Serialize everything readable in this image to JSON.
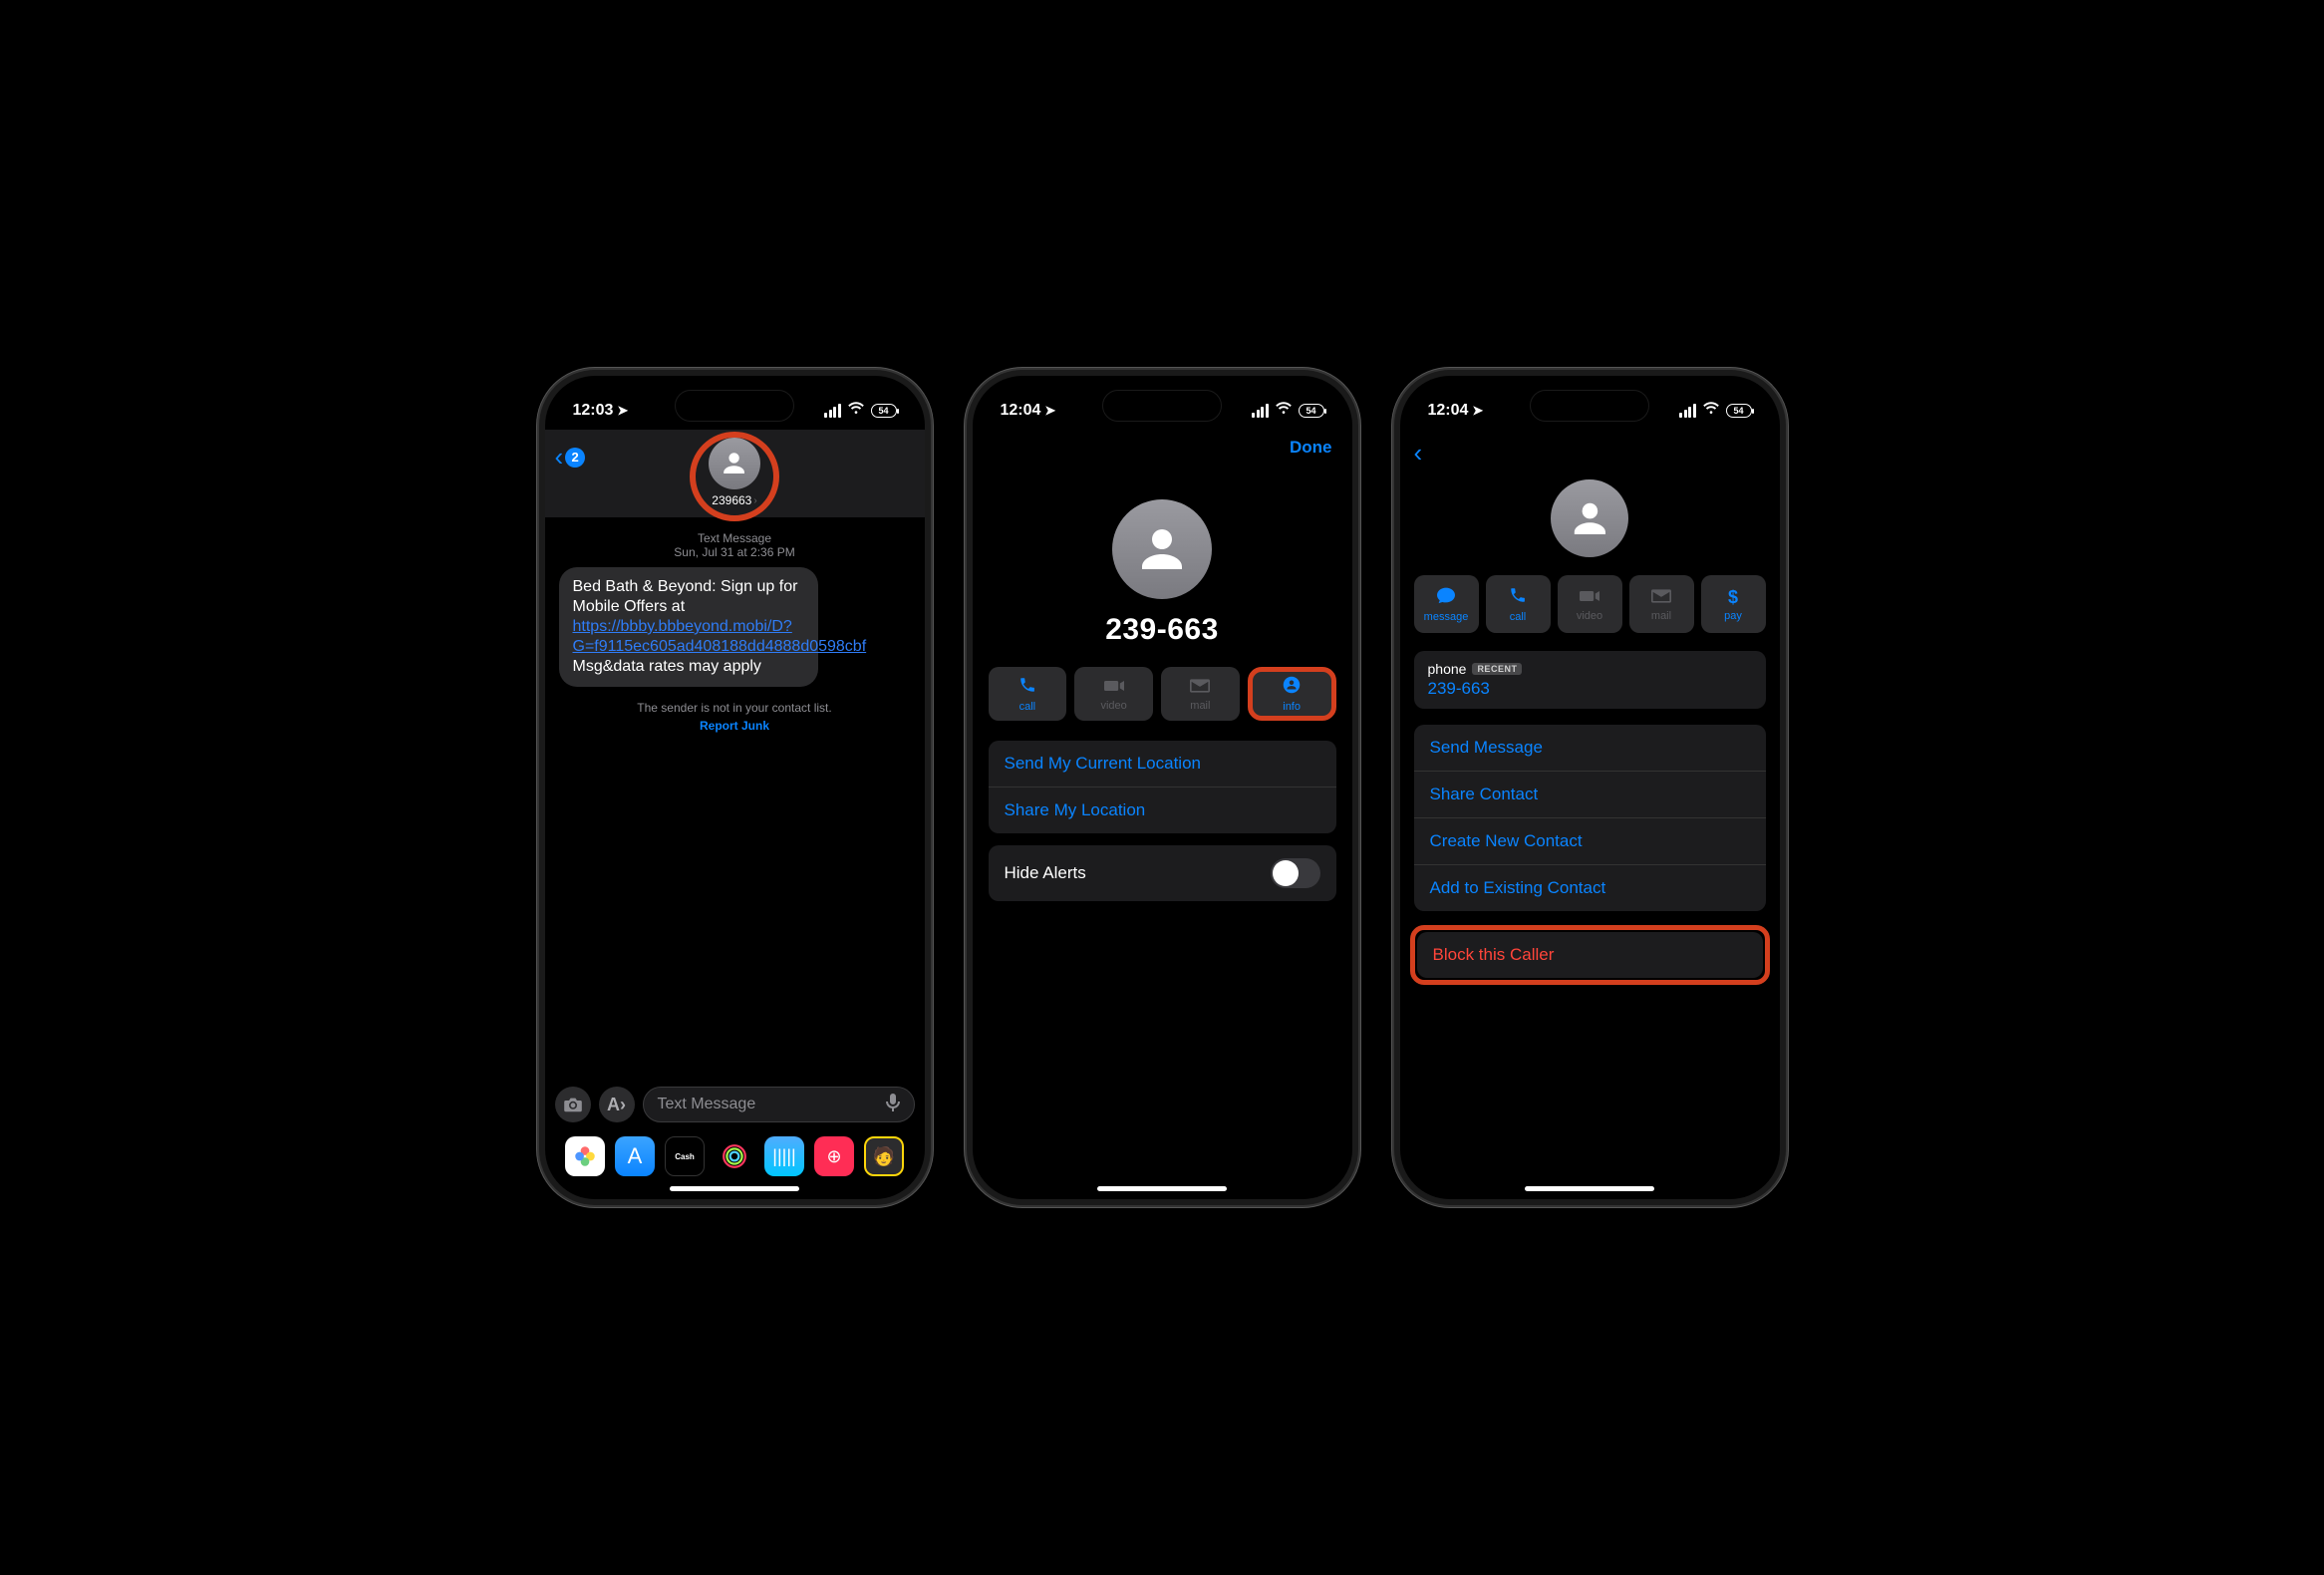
{
  "status": {
    "time1": "12:03",
    "time2": "12:04",
    "time3": "12:04",
    "battery": "54"
  },
  "screen1": {
    "back_count": "2",
    "contact": "239663",
    "meta_line1": "Text Message",
    "meta_line2": "Sun, Jul 31 at 2:36 PM",
    "msg_prefix": "Bed Bath & Beyond: Sign up for Mobile Offers at ",
    "msg_link": "https://bbby.bbbeyond.mobi/D?G=f9115ec605ad408188dd4888d0598cbf",
    "msg_suffix": " Msg&data rates may apply",
    "sender_note": "The sender is not in your contact list.",
    "report": "Report Junk",
    "placeholder": "Text Message",
    "cash_label": "Cash"
  },
  "screen2": {
    "done": "Done",
    "number": "239-663",
    "actions": {
      "call": "call",
      "video": "video",
      "mail": "mail",
      "info": "info"
    },
    "send_loc": "Send My Current Location",
    "share_loc": "Share My Location",
    "hide_alerts": "Hide Alerts"
  },
  "screen3": {
    "actions": {
      "message": "message",
      "call": "call",
      "video": "video",
      "mail": "mail",
      "pay": "pay"
    },
    "phone_label": "phone",
    "recent": "RECENT",
    "phone_number": "239-663",
    "send_message": "Send Message",
    "share_contact": "Share Contact",
    "create_contact": "Create New Contact",
    "add_existing": "Add to Existing Contact",
    "block": "Block this Caller"
  }
}
